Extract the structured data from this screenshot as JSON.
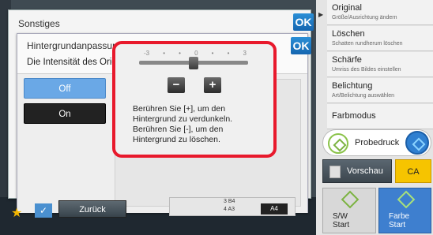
{
  "outer_dialog": {
    "title": "Sonstiges",
    "ok_label": "OK"
  },
  "inner_dialog": {
    "title": "Hintergrundanpassung",
    "description": "Die Intensität des Originalhintergrunds anpassen.",
    "ok_label": "OK",
    "options": [
      {
        "label": "Off",
        "selected": true
      },
      {
        "label": "On",
        "selected": false
      }
    ],
    "slider": {
      "ticks": [
        "-3",
        "•",
        "•",
        "0",
        "•",
        "•",
        "3"
      ],
      "value": 0,
      "min": -3,
      "max": 3
    },
    "minus_label": "−",
    "plus_label": "+",
    "help_text": "Berühren Sie [+], um den\nHintergrund zu verdunkeln.\nBerühren Sie [-], um den\nHintergrund zu löschen."
  },
  "right_menu": {
    "items": [
      {
        "title": "Original",
        "subtitle": "Größe/Ausrichtung ändern"
      },
      {
        "title": "Löschen",
        "subtitle": "Schatten rundherum löschen"
      },
      {
        "title": "Schärfe",
        "subtitle": "Umriss des Bildes einstellen"
      },
      {
        "title": "Belichtung",
        "subtitle": "Art/Belichtung auswählen"
      },
      {
        "title": "Farbmodus",
        "subtitle": ""
      }
    ],
    "probe_label": "Probedruck",
    "preview_label": "Vorschau",
    "ca_label": "CA",
    "sw_label": "S/W",
    "sw_start": "Start",
    "color_label": "Farbe",
    "color_start": "Start"
  },
  "bottom": {
    "back_label": "Zurück",
    "tray": {
      "row1": "3 B4",
      "row2": "4 A3",
      "selected": "A4"
    }
  },
  "colors": {
    "accent": "#1565b0",
    "highlight": "#e8192c",
    "ca": "#f6c400"
  }
}
